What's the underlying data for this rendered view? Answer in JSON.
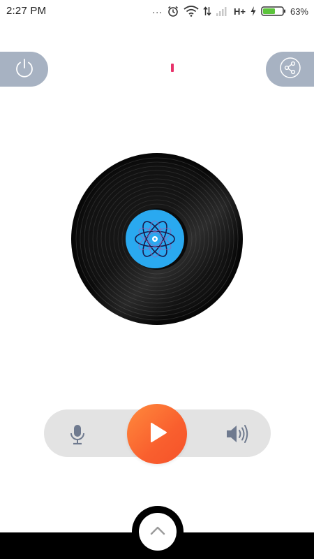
{
  "status_bar": {
    "time": "2:27 PM",
    "overflow": "...",
    "network_type": "H+",
    "battery_percent": "63%",
    "battery_level": 0.63,
    "icons": [
      "alarm-icon",
      "wifi-icon",
      "data-arrows-icon",
      "signal-icon",
      "charging-icon",
      "battery-icon"
    ]
  },
  "controls": {
    "power_icon": "power-icon",
    "share_icon": "share-icon",
    "mic_icon": "microphone-icon",
    "play_icon": "play-icon",
    "volume_icon": "volume-icon",
    "expand_icon": "chevron-up-icon"
  },
  "colors": {
    "pill_bg": "#a7b2c2",
    "accent": "#f95f2e",
    "control_bar_bg": "#e3e3e3",
    "indicator": "#e8326a",
    "label_blue": "#2aa9f0"
  }
}
